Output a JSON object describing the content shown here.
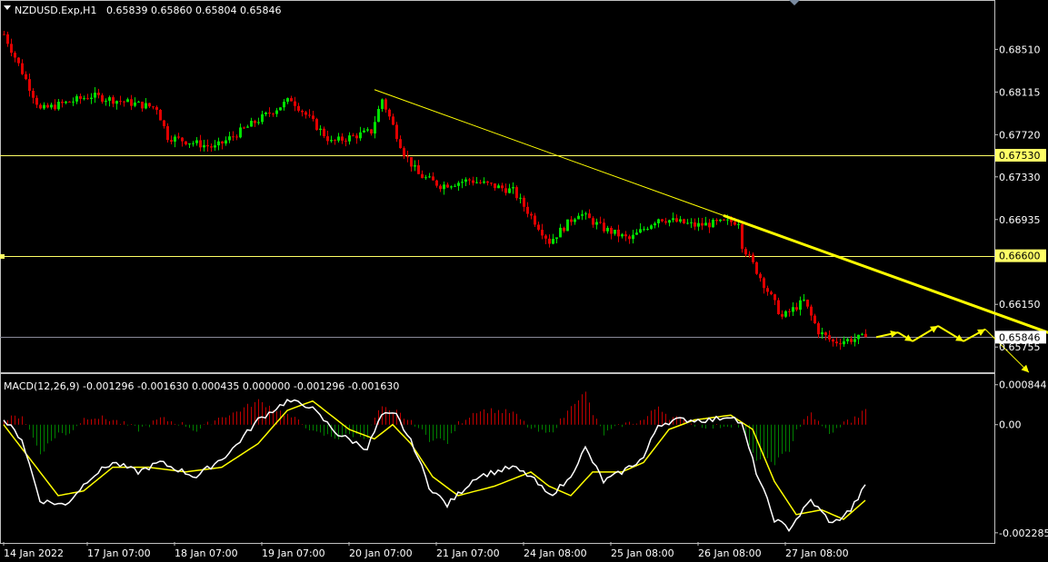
{
  "header": {
    "symbol": "NZDUSD.Exp,H1",
    "ohlc": "0.65839 0.65860 0.65804 0.65846"
  },
  "macd_header": "MACD(12,26,9) -0.001296 -0.001630 0.000435 0.000000 -0.001296 -0.001630",
  "colors": {
    "background": "#000000",
    "bull": "#00e000",
    "bear": "#e00000",
    "hline": "#ffff66",
    "trendline": "#ffff00",
    "macd_main": "#ffffff",
    "macd_signal": "#ffff00",
    "hist_pos": "#c00000",
    "hist_neg": "#008000"
  },
  "chart_data": [
    {
      "type": "candlestick",
      "name": "NZDUSD.Exp,H1",
      "y_ticks": [
        "0.68510",
        "0.68115",
        "0.67720",
        "0.67330",
        "0.66935",
        "0.66150",
        "0.65755"
      ],
      "ylim": [
        0.6553,
        0.6895
      ],
      "levels": [
        {
          "label": "0.67530",
          "value": 0.6753
        },
        {
          "label": "0.66600",
          "value": 0.666
        },
        {
          "label": "0.65846",
          "value": 0.65846
        }
      ],
      "x_labels": [
        "14 Jan 2022",
        "17 Jan 07:00",
        "18 Jan 07:00",
        "19 Jan 07:00",
        "20 Jan 07:00",
        "21 Jan 07:00",
        "24 Jan 08:00",
        "25 Jan 08:00",
        "26 Jan 08:00",
        "27 Jan 08:00"
      ],
      "x_label_bars": [
        0,
        23,
        47,
        71,
        95,
        119,
        143,
        167,
        191,
        215
      ],
      "anchors": [
        [
          0,
          0.6865
        ],
        [
          10,
          0.6795
        ],
        [
          24,
          0.6808
        ],
        [
          42,
          0.6797
        ],
        [
          45,
          0.677
        ],
        [
          58,
          0.676
        ],
        [
          72,
          0.679
        ],
        [
          79,
          0.6805
        ],
        [
          90,
          0.6765
        ],
        [
          101,
          0.6775
        ],
        [
          104,
          0.6805
        ],
        [
          110,
          0.6755
        ],
        [
          114,
          0.6735
        ],
        [
          120,
          0.6725
        ],
        [
          128,
          0.673
        ],
        [
          140,
          0.672
        ],
        [
          150,
          0.6673
        ],
        [
          158,
          0.67
        ],
        [
          165,
          0.6685
        ],
        [
          172,
          0.6675
        ],
        [
          180,
          0.6695
        ],
        [
          190,
          0.6688
        ],
        [
          202,
          0.6692
        ],
        [
          203,
          0.667
        ],
        [
          208,
          0.664
        ],
        [
          214,
          0.6603
        ],
        [
          220,
          0.6618
        ],
        [
          224,
          0.659
        ],
        [
          228,
          0.658
        ],
        [
          237,
          0.65846
        ]
      ],
      "trendline": [
        {
          "bar": 102,
          "price": 0.68137
        },
        {
          "bar": 290,
          "price": 0.65856
        }
      ],
      "projection": [
        [
          240,
          0.65846
        ],
        [
          246,
          0.6589
        ],
        [
          250,
          0.65808
        ],
        [
          257,
          0.6595
        ],
        [
          264,
          0.65808
        ],
        [
          270,
          0.6592
        ],
        [
          282,
          0.6552
        ]
      ]
    },
    {
      "type": "line",
      "name": "MACD(12,26,9)",
      "y_ticks": [
        "0.000844",
        "0.00",
        "-0.002285"
      ],
      "ylim": [
        -0.00248,
        0.00105
      ],
      "main_anchors": [
        [
          0,
          0.0001
        ],
        [
          5,
          -0.0003
        ],
        [
          10,
          -0.0016
        ],
        [
          17,
          -0.0017
        ],
        [
          24,
          -0.0011
        ],
        [
          30,
          -0.0008
        ],
        [
          37,
          -0.001
        ],
        [
          43,
          -0.0008
        ],
        [
          53,
          -0.0011
        ],
        [
          62,
          -0.0006
        ],
        [
          70,
          0.0001
        ],
        [
          78,
          0.0005
        ],
        [
          84,
          0.0004
        ],
        [
          92,
          -0.0002
        ],
        [
          100,
          -0.0005
        ],
        [
          104,
          0.0002
        ],
        [
          108,
          0.0002
        ],
        [
          113,
          -0.0005
        ],
        [
          117,
          -0.0013
        ],
        [
          122,
          -0.0017
        ],
        [
          130,
          -0.0011
        ],
        [
          140,
          -0.0009
        ],
        [
          145,
          -0.0011
        ],
        [
          150,
          -0.0015
        ],
        [
          155,
          -0.0012
        ],
        [
          160,
          -0.0005
        ],
        [
          165,
          -0.0012
        ],
        [
          170,
          -0.001
        ],
        [
          176,
          -0.0007
        ],
        [
          180,
          0.0
        ],
        [
          185,
          0.0001
        ],
        [
          195,
          0.0001
        ],
        [
          200,
          0.0002
        ],
        [
          203,
          0.0
        ],
        [
          207,
          -0.001
        ],
        [
          212,
          -0.002
        ],
        [
          216,
          -0.0022
        ],
        [
          222,
          -0.0016
        ],
        [
          228,
          -0.0021
        ],
        [
          233,
          -0.0018
        ],
        [
          237,
          -0.0013
        ]
      ],
      "signal_anchors": [
        [
          0,
          0.0
        ],
        [
          8,
          -0.0008
        ],
        [
          15,
          -0.0015
        ],
        [
          22,
          -0.0014
        ],
        [
          30,
          -0.0009
        ],
        [
          40,
          -0.0009
        ],
        [
          50,
          -0.001
        ],
        [
          60,
          -0.0009
        ],
        [
          70,
          -0.0004
        ],
        [
          78,
          0.0003
        ],
        [
          85,
          0.0005
        ],
        [
          95,
          -0.0001
        ],
        [
          102,
          -0.0003
        ],
        [
          107,
          0.0
        ],
        [
          112,
          -0.0004
        ],
        [
          118,
          -0.0011
        ],
        [
          125,
          -0.0015
        ],
        [
          135,
          -0.0013
        ],
        [
          145,
          -0.001
        ],
        [
          150,
          -0.0013
        ],
        [
          156,
          -0.0015
        ],
        [
          162,
          -0.001
        ],
        [
          170,
          -0.001
        ],
        [
          176,
          -0.0008
        ],
        [
          183,
          -0.0001
        ],
        [
          190,
          0.0001
        ],
        [
          200,
          0.0002
        ],
        [
          206,
          -0.0001
        ],
        [
          212,
          -0.0012
        ],
        [
          218,
          -0.0019
        ],
        [
          225,
          -0.0018
        ],
        [
          231,
          -0.002
        ],
        [
          237,
          -0.0016
        ]
      ]
    }
  ]
}
